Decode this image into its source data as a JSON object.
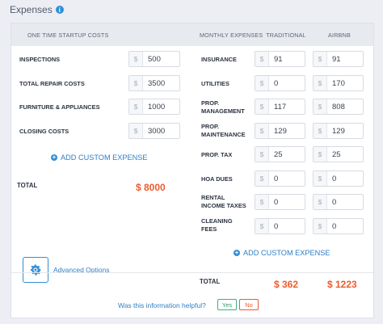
{
  "section": {
    "title": "Expenses"
  },
  "startup": {
    "header": "ONE TIME STARTUP COSTS",
    "currency": "$",
    "rows": [
      {
        "label": "INSPECTIONS",
        "value": "500"
      },
      {
        "label": "TOTAL REPAIR COSTS",
        "value": "3500"
      },
      {
        "label": "FURNITURE & APPLIANCES",
        "value": "1000"
      },
      {
        "label": "CLOSING COSTS",
        "value": "3000"
      }
    ],
    "add_label": "ADD CUSTOM EXPENSE",
    "total_label": "TOTAL",
    "total_value": "$ 8000"
  },
  "monthly": {
    "header": "MONTHLY EXPENSES",
    "col_traditional": "TRADITIONAL",
    "col_airbnb": "AIRBNB",
    "currency": "$",
    "rows": [
      {
        "label": "INSURANCE",
        "traditional": "91",
        "airbnb": "91"
      },
      {
        "label": "UTILITIES",
        "traditional": "0",
        "airbnb": "170"
      },
      {
        "label": "PROP.\nMANAGEMENT",
        "traditional": "117",
        "airbnb": "808"
      },
      {
        "label": "PROP.\nMAINTENANCE",
        "traditional": "129",
        "airbnb": "129"
      },
      {
        "label": "PROP. TAX",
        "traditional": "25",
        "airbnb": "25"
      },
      {
        "label": "HOA DUES",
        "traditional": "0",
        "airbnb": "0"
      },
      {
        "label": "RENTAL\nINCOME TAXES",
        "traditional": "0",
        "airbnb": "0"
      },
      {
        "label": "CLEANING\nFEES",
        "traditional": "0",
        "airbnb": "0"
      }
    ],
    "add_label": "ADD CUSTOM EXPENSE",
    "total_label": "TOTAL",
    "total_traditional": "$ 362",
    "total_airbnb": "$ 1223"
  },
  "advanced": {
    "label": "Advanced Options"
  },
  "feedback": {
    "question": "Was this information helpful?",
    "yes": "Yes",
    "no": "No"
  },
  "colors": {
    "accent": "#2f8fd8",
    "total": "#ef5a2d",
    "yes": "#3bb37c"
  },
  "icons": {
    "info": "info-icon",
    "gear": "gear-icon",
    "plus": "plus-circle-icon"
  }
}
